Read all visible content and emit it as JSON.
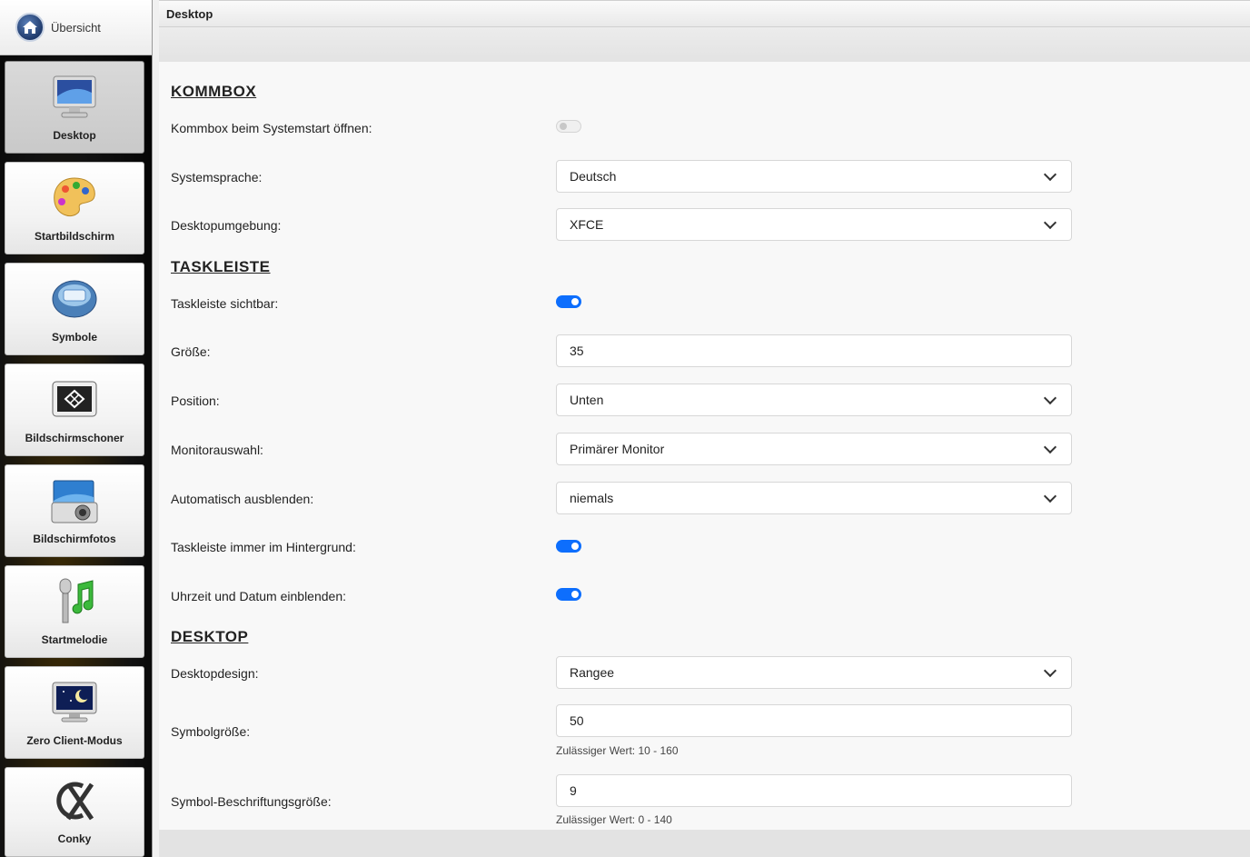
{
  "sidebar": {
    "home_label": "Übersicht",
    "items": [
      {
        "label": "Desktop",
        "icon": "monitor-icon",
        "active": true
      },
      {
        "label": "Startbildschirm",
        "icon": "palette-icon",
        "active": false
      },
      {
        "label": "Symbole",
        "icon": "icons-icon",
        "active": false
      },
      {
        "label": "Bildschirmschoner",
        "icon": "screensaver-icon",
        "active": false
      },
      {
        "label": "Bildschirmfotos",
        "icon": "camera-icon",
        "active": false
      },
      {
        "label": "Startmelodie",
        "icon": "microphone-music-icon",
        "active": false
      },
      {
        "label": "Zero Client-Modus",
        "icon": "moon-monitor-icon",
        "active": false
      },
      {
        "label": "Conky",
        "icon": "conky-icon",
        "active": false
      }
    ]
  },
  "header": {
    "title": "Desktop"
  },
  "kommbox": {
    "title": "KOMMBOX",
    "open_on_start_label": "Kommbox beim Systemstart öffnen:",
    "open_on_start": false,
    "language_label": "Systemsprache:",
    "language_value": "Deutsch",
    "desktop_env_label": "Desktopumgebung:",
    "desktop_env_value": "XFCE"
  },
  "taskleiste": {
    "title": "TASKLEISTE",
    "visible_label": "Taskleiste sichtbar:",
    "visible": true,
    "size_label": "Größe:",
    "size_value": "35",
    "position_label": "Position:",
    "position_value": "Unten",
    "monitor_label": "Monitorauswahl:",
    "monitor_value": "Primärer Monitor",
    "autohide_label": "Automatisch ausblenden:",
    "autohide_value": "niemals",
    "background_label": "Taskleiste immer im Hintergrund:",
    "background": true,
    "clock_label": "Uhrzeit und Datum einblenden:",
    "clock": true
  },
  "desktop": {
    "title": "DESKTOP",
    "design_label": "Desktopdesign:",
    "design_value": "Rangee",
    "icon_size_label": "Symbolgröße:",
    "icon_size_value": "50",
    "icon_size_hint": "Zulässiger Wert: 10 - 160",
    "label_size_label": "Symbol-Beschriftungsgröße:",
    "label_size_value": "9",
    "label_size_hint": "Zulässiger Wert: 0 - 140"
  },
  "colors": {
    "accent": "#0d6efd",
    "toggle_off": "#f0f0f0"
  }
}
